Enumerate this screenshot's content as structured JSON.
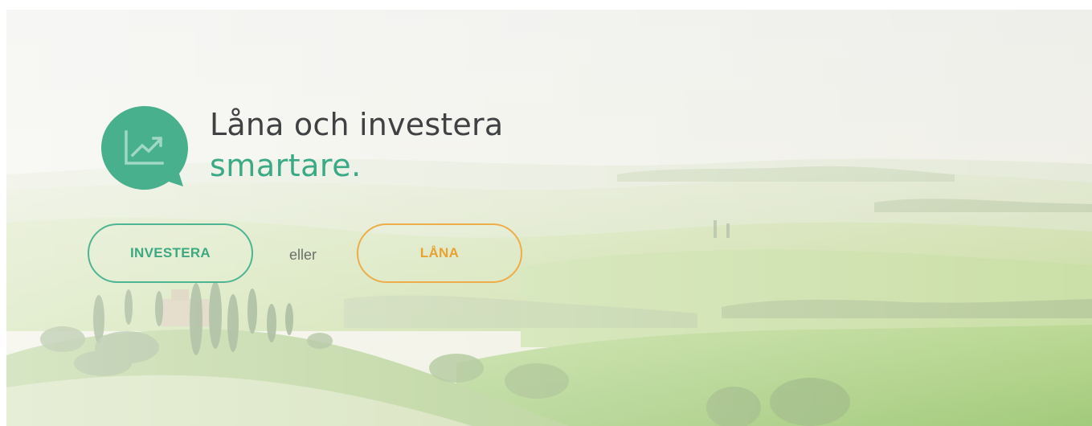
{
  "hero": {
    "headline_line1": "Låna och investera",
    "headline_line2": "smartare.",
    "invest_label": "INVESTERA",
    "or_label": "eller",
    "loan_label": "LÅNA",
    "logo_icon": "chart-growth-icon"
  },
  "colors": {
    "brand_green": "#3aaa86",
    "loan_orange": "#e8a232",
    "headline_dark": "#3f4142"
  }
}
